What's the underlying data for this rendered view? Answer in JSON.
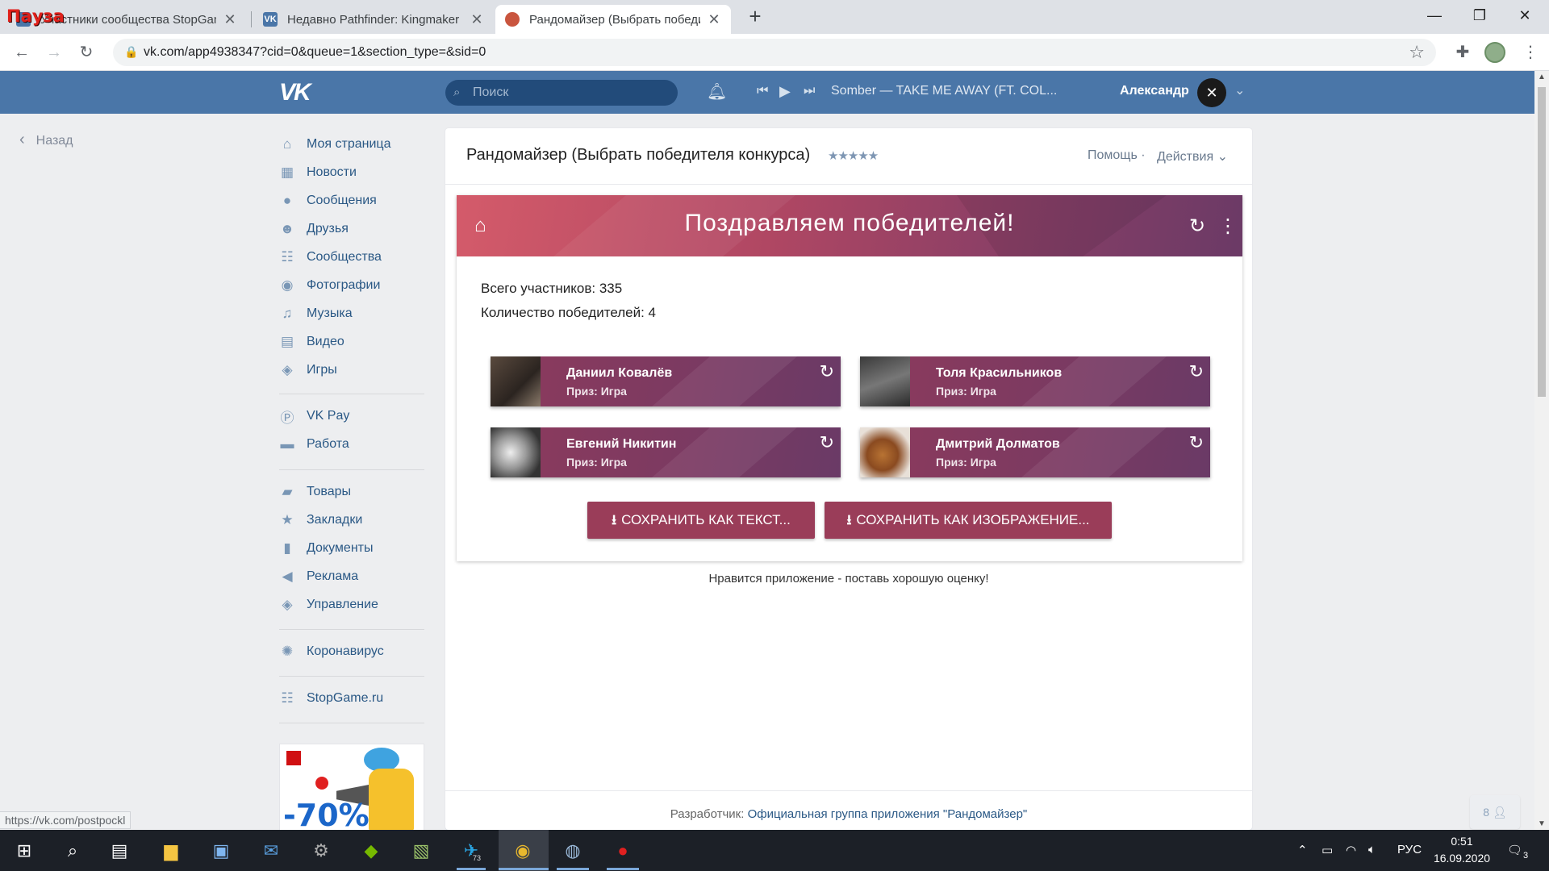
{
  "browser": {
    "tabs": [
      {
        "title": "Участники сообщества StopGame",
        "overlay": "Пауза"
      },
      {
        "title": "Недавно Pathfinder: Kingmaker",
        "favicon": "VK"
      },
      {
        "title": "Рандомайзер (Выбрать победит",
        "favicon": ""
      }
    ],
    "url": "vk.com/app4938347?cid=0&queue=1&section_type=&sid=0",
    "status_url": "https://vk.com/postpockl"
  },
  "vk_header": {
    "logo": "VK",
    "search_placeholder": "Поиск",
    "now_playing": "Somber — TAKE ME AWAY (FT. COL...",
    "user_name": "Александр"
  },
  "left_nav": {
    "back_label": "Назад",
    "group1": [
      {
        "label": "Моя страница",
        "icon": "home-icon"
      },
      {
        "label": "Новости",
        "icon": "news-icon"
      },
      {
        "label": "Сообщения",
        "icon": "messages-icon"
      },
      {
        "label": "Друзья",
        "icon": "friends-icon"
      },
      {
        "label": "Сообщества",
        "icon": "communities-icon"
      },
      {
        "label": "Фотографии",
        "icon": "photos-icon"
      },
      {
        "label": "Музыка",
        "icon": "music-icon"
      },
      {
        "label": "Видео",
        "icon": "video-icon"
      },
      {
        "label": "Игры",
        "icon": "games-icon"
      }
    ],
    "group2": [
      {
        "label": "VK Pay",
        "icon": "vkpay-icon"
      },
      {
        "label": "Работа",
        "icon": "work-icon"
      }
    ],
    "group3": [
      {
        "label": "Товары",
        "icon": "goods-icon"
      },
      {
        "label": "Закладки",
        "icon": "bookmarks-icon"
      },
      {
        "label": "Документы",
        "icon": "documents-icon"
      },
      {
        "label": "Реклама",
        "icon": "ads-icon"
      },
      {
        "label": "Управление",
        "icon": "manage-icon"
      }
    ],
    "group4": [
      {
        "label": "Коронавирус",
        "icon": "virus-icon"
      }
    ],
    "group5": [
      {
        "label": "StopGame.ru",
        "icon": "group-icon"
      }
    ],
    "promo_percent": "-70%"
  },
  "app": {
    "title": "Рандомайзер (Выбрать победителя конкурса)",
    "stars": "★★★★★",
    "help": "Помощь",
    "actions": "Действия",
    "banner_title": "Поздравляем победителей!",
    "total_participants": "Всего участников: 335",
    "winner_count": "Количество победителей: 4",
    "winners": [
      {
        "name": "Даниил Ковалёв",
        "prize": "Приз: Игра"
      },
      {
        "name": "Толя Красильников",
        "prize": "Приз: Игра"
      },
      {
        "name": "Евгений Никитин",
        "prize": "Приз: Игра"
      },
      {
        "name": "Дмитрий Долматов",
        "prize": "Приз: Игра"
      }
    ],
    "save_text_button": "СОХРАНИТЬ КАК ТЕКСТ...",
    "save_image_button": "СОХРАНИТЬ КАК ИЗОБРАЖЕНИЕ...",
    "rate_prompt": "Нравится приложение - поставь хорошую оценку!",
    "developer_prefix": "Разработчик:",
    "developer_link": "Официальная группа приложения \"Рандомайзер\"",
    "online_count": "8"
  },
  "taskbar": {
    "telegram_badge": "73",
    "language": "РУС",
    "time": "0:51",
    "date": "16.09.2020",
    "notifications": "3"
  },
  "colors": {
    "vk_blue": "#4a76a8",
    "banner_pink": "#d45b6a",
    "card_plum": "#8d3a5c",
    "button": "#9a3d59"
  }
}
